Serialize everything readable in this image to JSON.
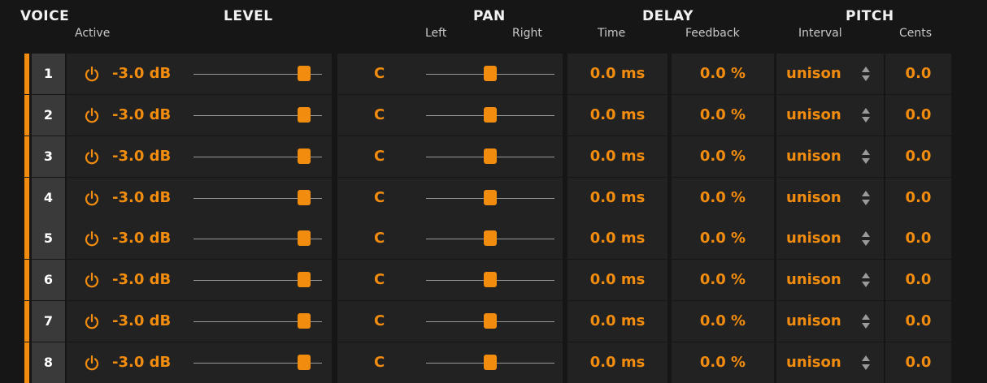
{
  "headers": {
    "voice": "VOICE",
    "level": "LEVEL",
    "pan": "PAN",
    "delay": "DELAY",
    "pitch": "PITCH"
  },
  "subheaders": {
    "active": "Active",
    "left": "Left",
    "right": "Right",
    "time": "Time",
    "feedback": "Feedback",
    "interval": "Interval",
    "cents": "Cents"
  },
  "accent_color": "#f28c0f",
  "voices": [
    {
      "number": "1",
      "level": "-3.0 dB",
      "level_fraction": 0.86,
      "pan": "C",
      "pan_fraction": 0.5,
      "time": "0.0 ms",
      "feedback": "0.0 %",
      "interval": "unison",
      "cents": "0.0"
    },
    {
      "number": "2",
      "level": "-3.0 dB",
      "level_fraction": 0.86,
      "pan": "C",
      "pan_fraction": 0.5,
      "time": "0.0 ms",
      "feedback": "0.0 %",
      "interval": "unison",
      "cents": "0.0"
    },
    {
      "number": "3",
      "level": "-3.0 dB",
      "level_fraction": 0.86,
      "pan": "C",
      "pan_fraction": 0.5,
      "time": "0.0 ms",
      "feedback": "0.0 %",
      "interval": "unison",
      "cents": "0.0"
    },
    {
      "number": "4",
      "level": "-3.0 dB",
      "level_fraction": 0.86,
      "pan": "C",
      "pan_fraction": 0.5,
      "time": "0.0 ms",
      "feedback": "0.0 %",
      "interval": "unison",
      "cents": "0.0"
    },
    {
      "number": "5",
      "level": "-3.0 dB",
      "level_fraction": 0.86,
      "pan": "C",
      "pan_fraction": 0.5,
      "time": "0.0 ms",
      "feedback": "0.0 %",
      "interval": "unison",
      "cents": "0.0"
    },
    {
      "number": "6",
      "level": "-3.0 dB",
      "level_fraction": 0.86,
      "pan": "C",
      "pan_fraction": 0.5,
      "time": "0.0 ms",
      "feedback": "0.0 %",
      "interval": "unison",
      "cents": "0.0"
    },
    {
      "number": "7",
      "level": "-3.0 dB",
      "level_fraction": 0.86,
      "pan": "C",
      "pan_fraction": 0.5,
      "time": "0.0 ms",
      "feedback": "0.0 %",
      "interval": "unison",
      "cents": "0.0"
    },
    {
      "number": "8",
      "level": "-3.0 dB",
      "level_fraction": 0.86,
      "pan": "C",
      "pan_fraction": 0.5,
      "time": "0.0 ms",
      "feedback": "0.0 %",
      "interval": "unison",
      "cents": "0.0"
    }
  ]
}
